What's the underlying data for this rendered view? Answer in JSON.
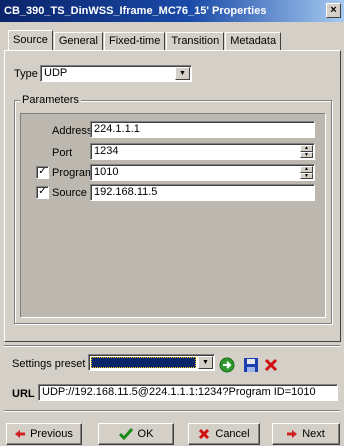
{
  "window": {
    "title": "CB_390_TS_DinWSS_Iframe_MC76_15' Properties",
    "close": "×"
  },
  "tabs": [
    {
      "label": "Source"
    },
    {
      "label": "General"
    },
    {
      "label": "Fixed-time"
    },
    {
      "label": "Transition"
    },
    {
      "label": "Metadata"
    }
  ],
  "source": {
    "type_label": "Type",
    "type_value": "UDP",
    "parameters_title": "Parameters",
    "address_label": "Address",
    "address_value": "224.1.1.1",
    "port_label": "Port",
    "port_value": "1234",
    "program_id_label": "Program ID",
    "program_id_checked": true,
    "program_id_value": "1010",
    "source_label": "Source",
    "source_checked": true,
    "source_value": "192.168.11.5"
  },
  "footer": {
    "settings_preset_label": "Settings preset",
    "settings_preset_value": "",
    "url_label": "URL",
    "url_value": "UDP://192.168.11.5@224.1.1.1:1234?Program ID=1010",
    "previous_label": "Previous",
    "ok_label": "OK",
    "cancel_label": "Cancel",
    "next_label": "Next"
  },
  "colors": {
    "title_bar": "#0a246a",
    "preset_selected": "#0a246a",
    "apply_icon": "#2e9a2e",
    "save_icon": "#1a3fb0",
    "delete_icon": "#d01010"
  },
  "icons": {
    "apply": "green-arrow-circle-icon",
    "save": "floppy-disk-icon",
    "delete": "red-x-icon",
    "previous": "left-arrow-icon",
    "ok": "checkmark-icon",
    "cancel": "red-x-icon",
    "next": "right-arrow-icon"
  }
}
